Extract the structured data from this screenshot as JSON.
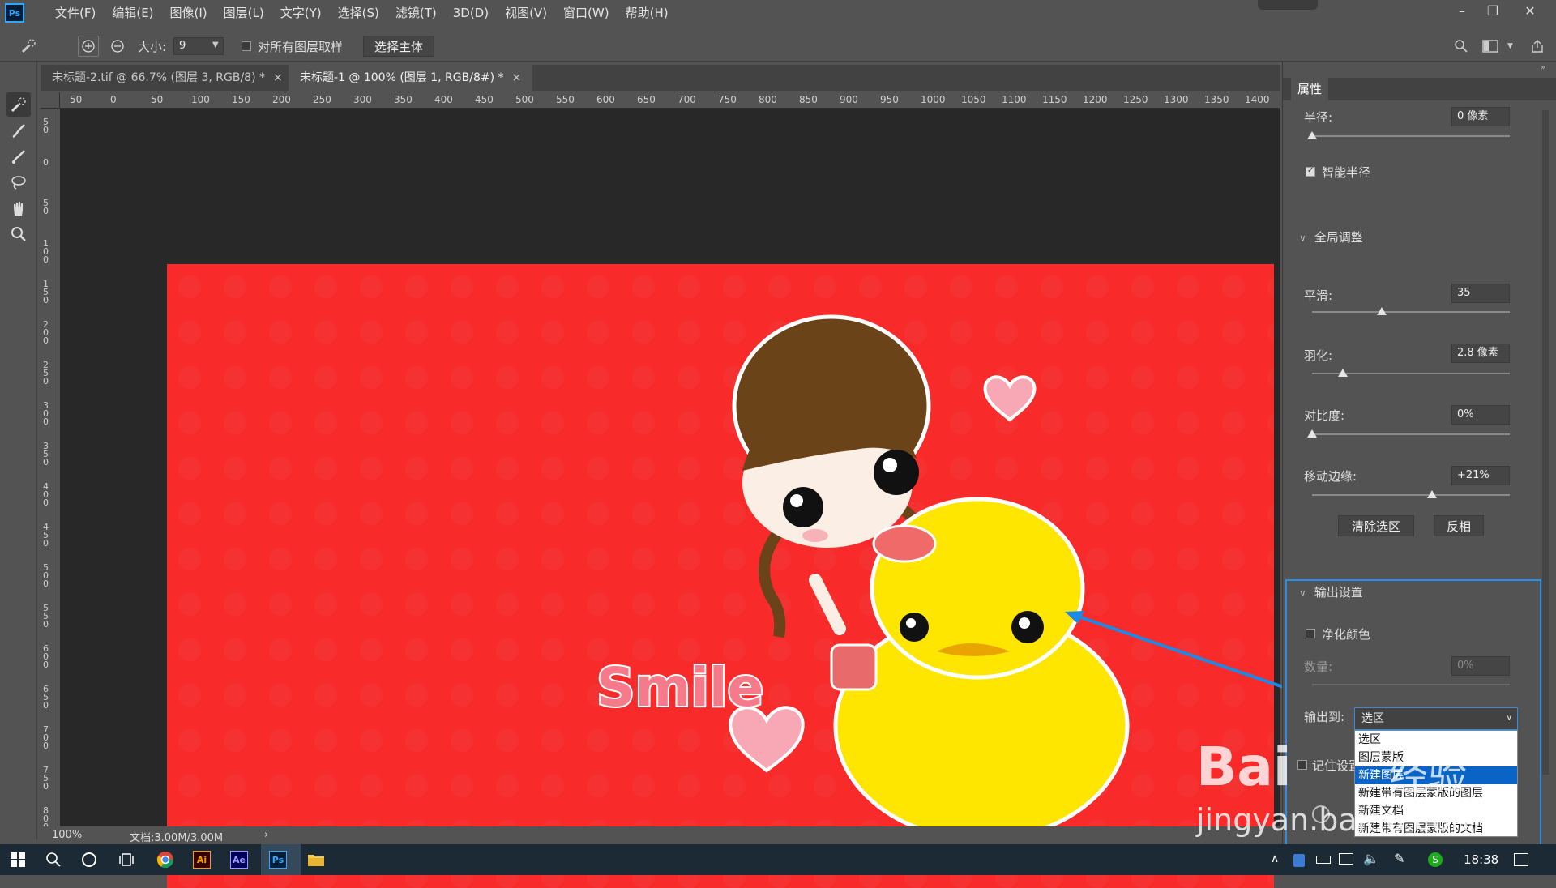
{
  "app": {
    "logo": "Ps",
    "accent": "#31a8ff"
  },
  "menu": [
    "文件(F)",
    "编辑(E)",
    "图像(I)",
    "图层(L)",
    "文字(Y)",
    "选择(S)",
    "滤镜(T)",
    "3D(D)",
    "视图(V)",
    "窗口(W)",
    "帮助(H)"
  ],
  "window_controls": {
    "minimize": "–",
    "restore": "❐",
    "close": "✕"
  },
  "options": {
    "size_label": "大小:",
    "size_value": "9",
    "sample_all_label": "对所有图层取样",
    "select_subject": "选择主体"
  },
  "tabs": [
    {
      "label": "未标题-2.tif @ 66.7% (图层 3, RGB/8) *",
      "close": "×"
    },
    {
      "label": "未标题-1 @ 100% (图层 1, RGB/8#) *",
      "close": "×"
    }
  ],
  "ruler_h": [
    "50",
    "0",
    "50",
    "100",
    "150",
    "200",
    "250",
    "300",
    "350",
    "400",
    "450",
    "500",
    "550",
    "600",
    "650",
    "700",
    "750",
    "800",
    "850",
    "900",
    "950",
    "1000",
    "1050",
    "1100",
    "1150",
    "1200",
    "1250",
    "1300",
    "1350",
    "1400"
  ],
  "ruler_v": [
    "50",
    "0",
    "50",
    "100",
    "150",
    "200",
    "250",
    "300",
    "350",
    "400",
    "450",
    "500",
    "550",
    "600",
    "650",
    "700",
    "750",
    "800"
  ],
  "canvas": {
    "bg_color": "#f82a2a",
    "smile_text": "Smile"
  },
  "status": {
    "zoom": "100%",
    "doc": "文档:3.00M/3.00M",
    "arrow": "›"
  },
  "panel": {
    "title": "属性",
    "radius_label": "半径:",
    "radius_value": "0 像素",
    "smart_radius": "智能半径",
    "global_refine": "全局调整",
    "smooth_label": "平滑:",
    "smooth_value": "35",
    "feather_label": "羽化:",
    "feather_value": "2.8 像素",
    "contrast_label": "对比度:",
    "contrast_value": "0%",
    "shift_edge_label": "移动边缘:",
    "shift_edge_value": "+21%",
    "clear_selection": "清除选区",
    "invert": "反相",
    "output_settings": "输出设置",
    "decontaminate": "净化颜色",
    "amount_label": "数量:",
    "amount_value": "0%",
    "output_to_label": "输出到:",
    "output_to_value": "选区",
    "output_options": [
      "选区",
      "图层蒙版",
      "新建图层",
      "新建带有图层蒙版的图层",
      "新建文档",
      "新建带有图层蒙版的文档"
    ],
    "output_selected": 2,
    "remember_label": "记住设置"
  },
  "taskbar": {
    "clock": "18:38",
    "ai": "Ai",
    "ae": "Ae",
    "ps": "Ps"
  },
  "watermark": {
    "line1": "Bai",
    "line2": "经验",
    "line3": "jingyan.baidu.com"
  }
}
